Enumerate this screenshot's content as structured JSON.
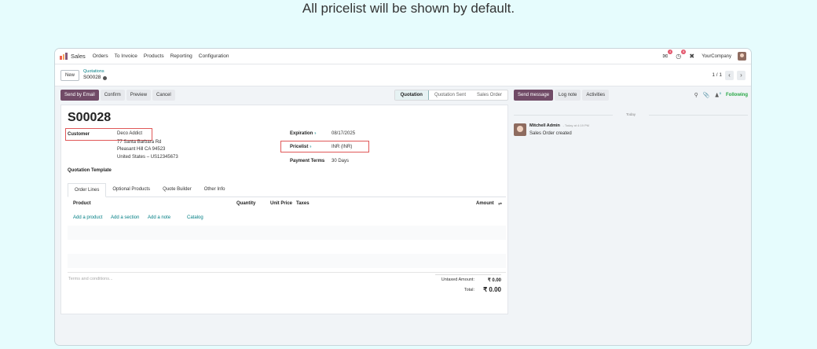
{
  "caption": "All pricelist will be shown by default.",
  "topbar": {
    "app_name": "Sales",
    "menu": [
      "Orders",
      "To Invoice",
      "Products",
      "Reporting",
      "Configuration"
    ],
    "chat_badge": "4",
    "activity_badge": "8",
    "company": "YourCompany"
  },
  "control": {
    "new_label": "New",
    "breadcrumb_parent": "Quotations",
    "breadcrumb_current": "S00028",
    "pager": "1 / 1"
  },
  "actions": {
    "send_email": "Send by Email",
    "confirm": "Confirm",
    "preview": "Preview",
    "cancel": "Cancel"
  },
  "status": [
    "Quotation",
    "Quotation Sent",
    "Sales Order"
  ],
  "form": {
    "title": "S00028",
    "customer_label": "Customer",
    "customer_name": "Deco Addict",
    "address_1": "77 Santa Barbara Rd",
    "address_2": "Pleasant Hill CA 94523",
    "address_3": "United States – US12345673",
    "expiration_label": "Expiration",
    "expiration_value": "08/17/2025",
    "pricelist_label": "Pricelist",
    "pricelist_value": "INR (INR)",
    "payment_terms_label": "Payment Terms",
    "payment_terms_value": "30 Days",
    "quotation_template_label": "Quotation Template",
    "help_mark": "?"
  },
  "tabs": [
    "Order Lines",
    "Optional Products",
    "Quote Builder",
    "Other Info"
  ],
  "table": {
    "headers": {
      "product": "Product",
      "quantity": "Quantity",
      "unit_price": "Unit Price",
      "taxes": "Taxes",
      "amount": "Amount"
    },
    "add_links": [
      "Add a product",
      "Add a section",
      "Add a note",
      "Catalog"
    ]
  },
  "footer": {
    "terms_placeholder": "Terms and conditions...",
    "untaxed_label": "Untaxed Amount:",
    "untaxed_value": "₹ 0.00",
    "total_label": "Total:",
    "total_value": "₹ 0.00"
  },
  "chatter": {
    "send_message": "Send message",
    "log_note": "Log note",
    "activities": "Activities",
    "followers_count": "0",
    "following": "Following",
    "date_separator": "Today",
    "author": "Mitchell Admin",
    "time": "- Today at 4:19 PM",
    "message": "Sales Order created"
  },
  "colors": {
    "primary": "#714b67",
    "link": "#017e84",
    "highlight_box": "#e05858",
    "following": "#28a745",
    "background": "#e6fcfd"
  }
}
